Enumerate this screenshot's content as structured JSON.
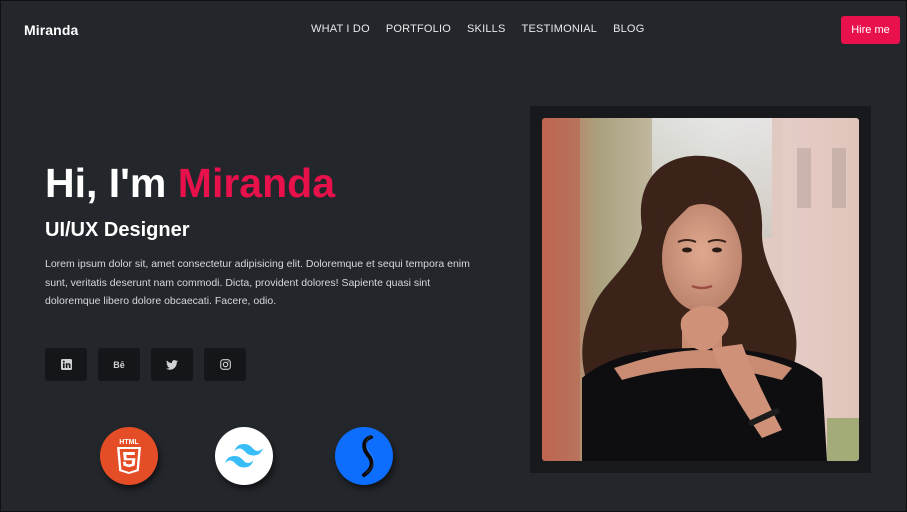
{
  "nav": {
    "brand": "Miranda",
    "links": [
      "WHAT I DO",
      "PORTFOLIO",
      "SKILLS",
      "TESTIMONIAL",
      "BLOG"
    ],
    "cta": "Hire me"
  },
  "hero": {
    "greeting": "Hi, I'm",
    "name": "Miranda",
    "role": "UI/UX Designer",
    "description": "Lorem ipsum dolor sit, amet consectetur adipisicing elit. Doloremque et sequi tempora enim sunt, veritatis deserunt nam commodi. Dicta, provident dolores! Sapiente quasi sint doloremque libero dolore obcaecati. Facere, odio."
  },
  "social": {
    "icons": [
      "linkedin-icon",
      "behance-icon",
      "twitter-icon",
      "instagram-icon"
    ],
    "behance_text": "Bē"
  },
  "tech": {
    "icons": [
      "html5-icon",
      "tailwind-icon",
      "styled-icon"
    ],
    "html_label": "HTML"
  },
  "colors": {
    "accent": "#e8114c",
    "background": "#23262b",
    "card": "#141619"
  }
}
